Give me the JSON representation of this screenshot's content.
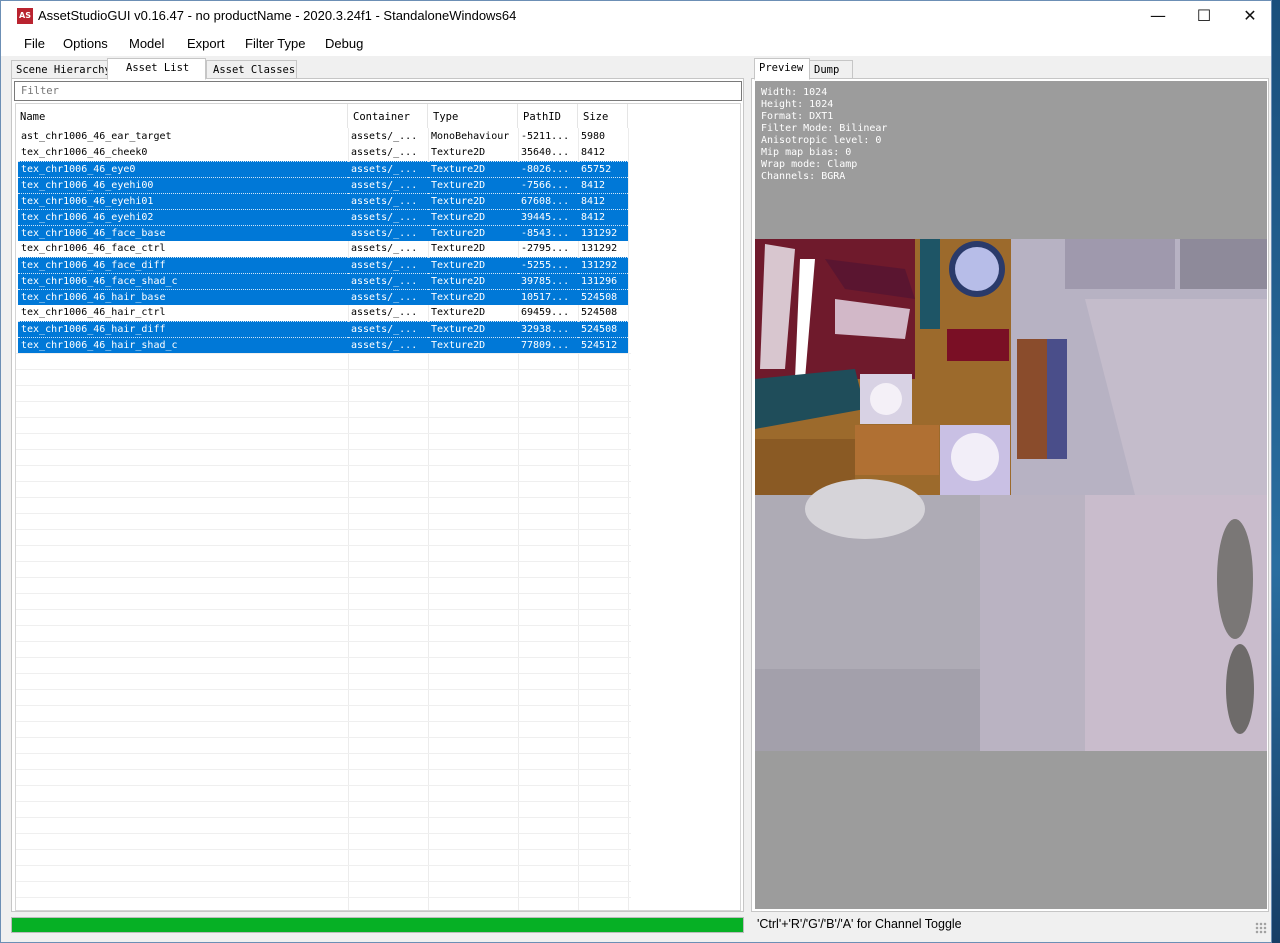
{
  "window": {
    "title": "AssetStudioGUI v0.16.47 - no productName - 2020.3.24f1 - StandaloneWindows64",
    "icon_label": "AS",
    "minimize_glyph": "—",
    "maximize_glyph": "☐",
    "close_glyph": "✕"
  },
  "menu": [
    "File",
    "Options",
    "Model",
    "Export",
    "Filter Type",
    "Debug"
  ],
  "left_tabs": [
    "Scene Hierarchy",
    "Asset List",
    "Asset Classes"
  ],
  "filter": {
    "placeholder": "Filter",
    "value": ""
  },
  "columns": [
    "Name",
    "Container",
    "Type",
    "PathID",
    "Size"
  ],
  "rows": [
    {
      "name": "ast_chr1006_46_ear_target",
      "container": "assets/_...",
      "type": "MonoBehaviour",
      "pathid": "-5211...",
      "size": "5980",
      "selected": false
    },
    {
      "name": "tex_chr1006_46_cheek0",
      "container": "assets/_...",
      "type": "Texture2D",
      "pathid": "35640...",
      "size": "8412",
      "selected": false
    },
    {
      "name": "tex_chr1006_46_eye0",
      "container": "assets/_...",
      "type": "Texture2D",
      "pathid": "-8026...",
      "size": "65752",
      "selected": true
    },
    {
      "name": "tex_chr1006_46_eyehi00",
      "container": "assets/_...",
      "type": "Texture2D",
      "pathid": "-7566...",
      "size": "8412",
      "selected": true
    },
    {
      "name": "tex_chr1006_46_eyehi01",
      "container": "assets/_...",
      "type": "Texture2D",
      "pathid": "67608...",
      "size": "8412",
      "selected": true
    },
    {
      "name": "tex_chr1006_46_eyehi02",
      "container": "assets/_...",
      "type": "Texture2D",
      "pathid": "39445...",
      "size": "8412",
      "selected": true
    },
    {
      "name": "tex_chr1006_46_face_base",
      "container": "assets/_...",
      "type": "Texture2D",
      "pathid": "-8543...",
      "size": "131292",
      "selected": true
    },
    {
      "name": "tex_chr1006_46_face_ctrl",
      "container": "assets/_...",
      "type": "Texture2D",
      "pathid": "-2795...",
      "size": "131292",
      "selected": false
    },
    {
      "name": "tex_chr1006_46_face_diff",
      "container": "assets/_...",
      "type": "Texture2D",
      "pathid": "-5255...",
      "size": "131292",
      "selected": true
    },
    {
      "name": "tex_chr1006_46_face_shad_c",
      "container": "assets/_...",
      "type": "Texture2D",
      "pathid": "39785...",
      "size": "131296",
      "selected": true
    },
    {
      "name": "tex_chr1006_46_hair_base",
      "container": "assets/_...",
      "type": "Texture2D",
      "pathid": "10517...",
      "size": "524508",
      "selected": true
    },
    {
      "name": "tex_chr1006_46_hair_ctrl",
      "container": "assets/_...",
      "type": "Texture2D",
      "pathid": "69459...",
      "size": "524508",
      "selected": false
    },
    {
      "name": "tex_chr1006_46_hair_diff",
      "container": "assets/_...",
      "type": "Texture2D",
      "pathid": "32938...",
      "size": "524508",
      "selected": true
    },
    {
      "name": "tex_chr1006_46_hair_shad_c",
      "container": "assets/_...",
      "type": "Texture2D",
      "pathid": "77809...",
      "size": "524512",
      "selected": true
    }
  ],
  "progress": 1.0,
  "right_tabs": [
    "Preview",
    "Dump"
  ],
  "preview_info": [
    "Width: 1024",
    "Height: 1024",
    "Format: DXT1",
    "Filter Mode: Bilinear",
    "Anisotropic level: 0",
    "Mip map bias: 0",
    "Wrap mode: Clamp",
    "Channels: BGRA"
  ],
  "status_text": "'Ctrl'+'R'/'G'/'B'/'A' for Channel Toggle",
  "colors": {
    "selection": "#0078d7",
    "progress": "#06b025",
    "preview_bg": "#9c9c9c"
  }
}
